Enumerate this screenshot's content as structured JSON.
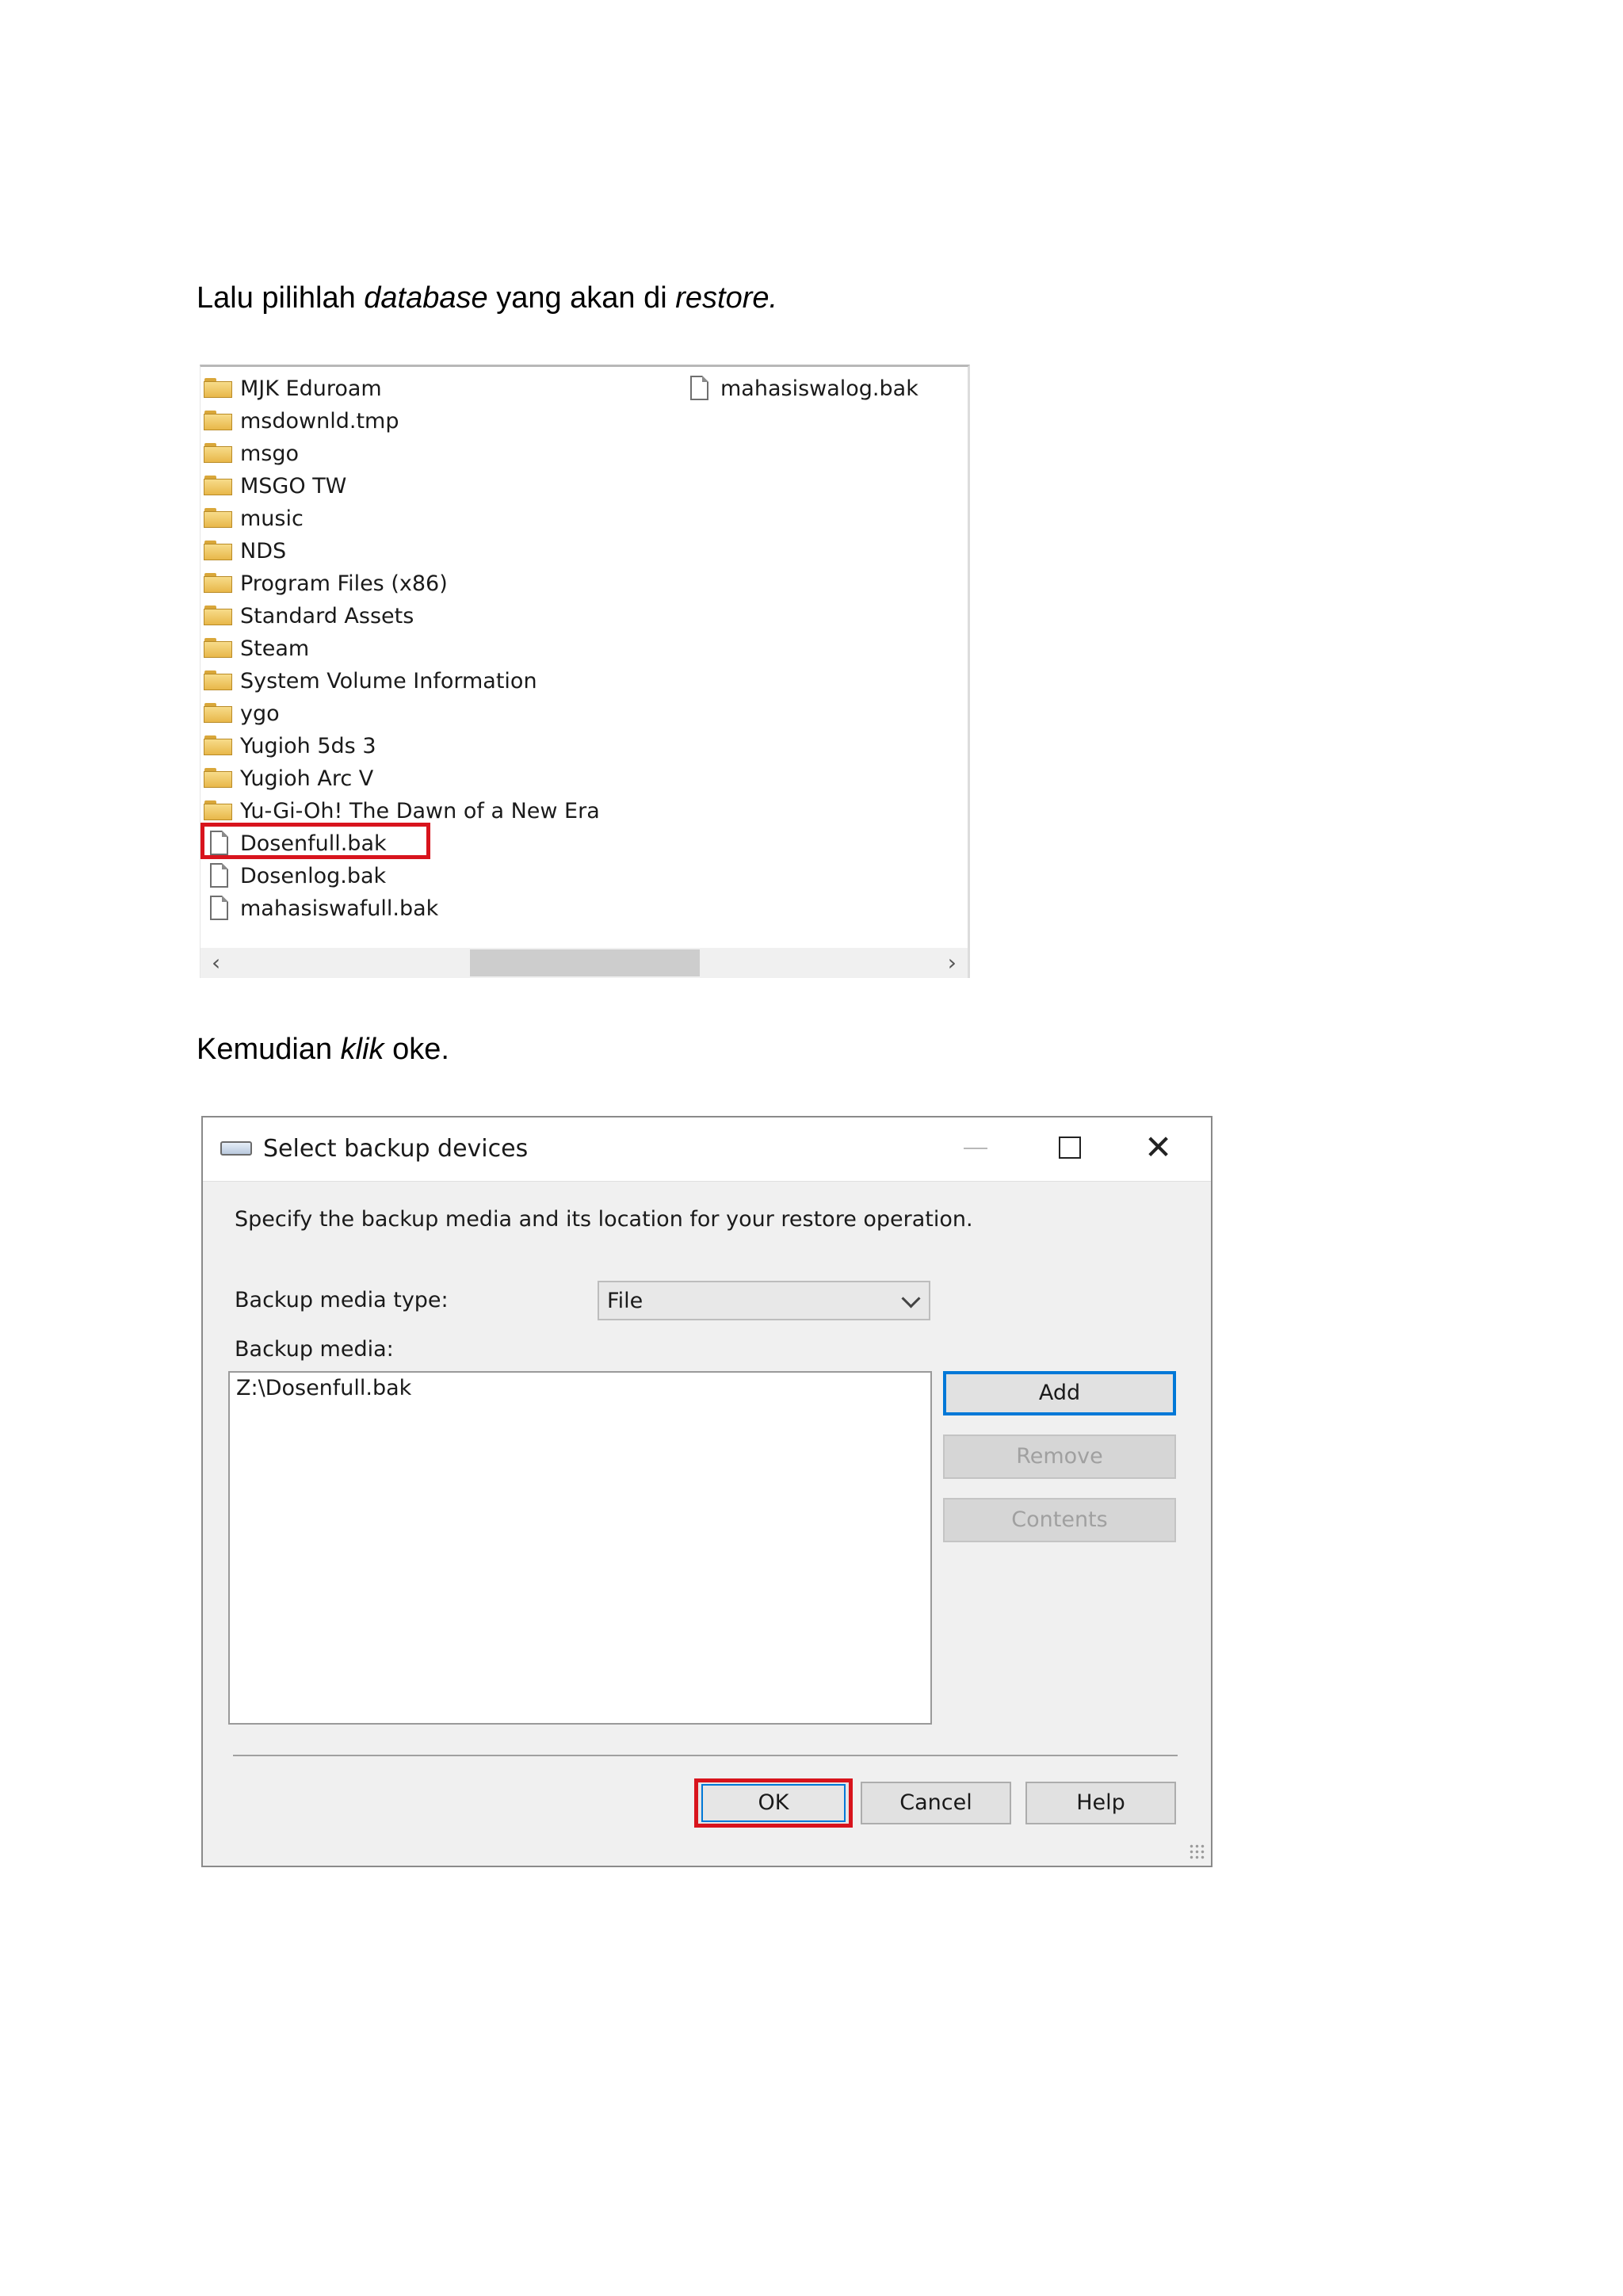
{
  "instruction_1": {
    "text_before": "Lalu pilihlah ",
    "italic_1": "database",
    "text_mid": " yang akan di ",
    "italic_2": "restore."
  },
  "file_browser": {
    "items_col1": [
      {
        "name": "MJK Eduroam",
        "icon": "folder-icon"
      },
      {
        "name": "msdownld.tmp",
        "icon": "folder-icon"
      },
      {
        "name": "msgo",
        "icon": "folder-icon"
      },
      {
        "name": "MSGO TW",
        "icon": "folder-icon"
      },
      {
        "name": "music",
        "icon": "folder-icon"
      },
      {
        "name": "NDS",
        "icon": "folder-icon"
      },
      {
        "name": "Program Files (x86)",
        "icon": "folder-icon"
      },
      {
        "name": "Standard Assets",
        "icon": "folder-icon"
      },
      {
        "name": "Steam",
        "icon": "folder-icon"
      },
      {
        "name": "System Volume Information",
        "icon": "folder-icon"
      },
      {
        "name": "ygo",
        "icon": "folder-icon"
      },
      {
        "name": "Yugioh 5ds 3",
        "icon": "folder-icon"
      },
      {
        "name": "Yugioh Arc V",
        "icon": "folder-icon"
      },
      {
        "name": "Yu-Gi-Oh! The Dawn of a New Era",
        "icon": "folder-icon"
      },
      {
        "name": "Dosenfull.bak",
        "icon": "file-icon",
        "highlighted": true
      },
      {
        "name": "Dosenlog.bak",
        "icon": "file-icon"
      },
      {
        "name": "mahasiswafull.bak",
        "icon": "file-icon"
      }
    ],
    "items_col2": [
      {
        "name": "mahasiswalog.bak",
        "icon": "file-icon"
      }
    ],
    "highlight_color": "#d8141d"
  },
  "instruction_2": {
    "text_before": "Kemudian ",
    "italic": "klik",
    "text_after": " oke."
  },
  "dialog": {
    "title": "Select backup devices",
    "description": "Specify the backup media and its location for your restore operation.",
    "media_type_label": "Backup media type:",
    "media_type_value": "File",
    "media_label": "Backup media:",
    "media_items": [
      "Z:\\Dosenfull.bak"
    ],
    "buttons": {
      "add": "Add",
      "remove": "Remove",
      "contents": "Contents",
      "ok": "OK",
      "cancel": "Cancel",
      "help": "Help"
    },
    "accent_color": "#0078d7"
  }
}
